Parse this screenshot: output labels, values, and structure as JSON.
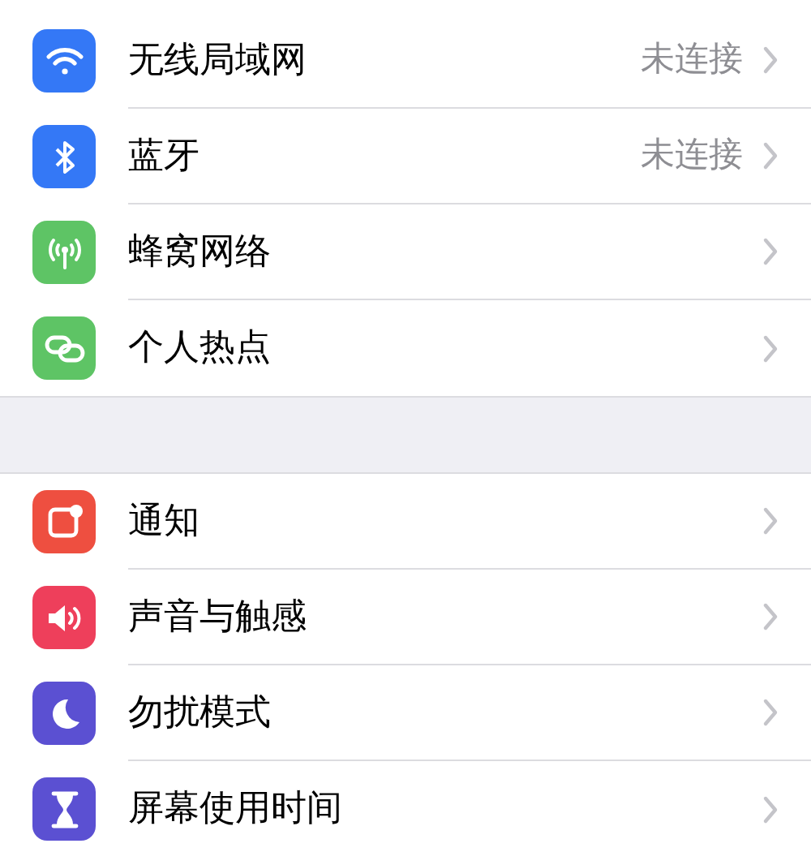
{
  "groups": [
    {
      "items": [
        {
          "kind": "wifi",
          "color": "#3478f6",
          "label": "无线局域网",
          "value": "未连接"
        },
        {
          "kind": "bluetooth",
          "color": "#3478f6",
          "label": "蓝牙",
          "value": "未连接"
        },
        {
          "kind": "cellular",
          "color": "#5ec465",
          "label": "蜂窝网络"
        },
        {
          "kind": "hotspot",
          "color": "#5ec465",
          "label": "个人热点"
        }
      ]
    },
    {
      "items": [
        {
          "kind": "notifications",
          "color": "#ee4f40",
          "label": "通知"
        },
        {
          "kind": "sounds",
          "color": "#ee3f5b",
          "label": "声音与触感"
        },
        {
          "kind": "moon",
          "color": "#5b50d2",
          "label": "勿扰模式"
        },
        {
          "kind": "hourglass",
          "color": "#5b50d2",
          "label": "屏幕使用时间"
        }
      ]
    }
  ]
}
